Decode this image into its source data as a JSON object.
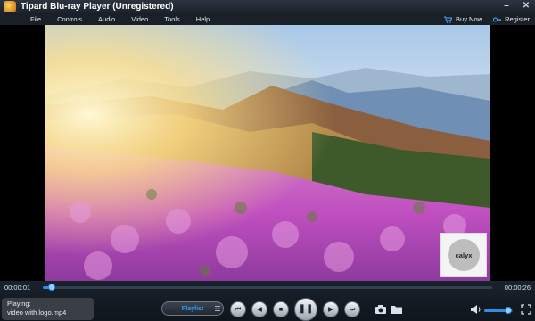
{
  "window": {
    "title": "Tipard Blu-ray Player (Unregistered)",
    "minimize_symbol": "–",
    "close_symbol": "✕"
  },
  "menu": {
    "items": [
      "File",
      "Controls",
      "Audio",
      "Video",
      "Tools",
      "Help"
    ],
    "buy_now": "Buy Now",
    "register": "Register"
  },
  "video": {
    "watermark_text": "calyx"
  },
  "player": {
    "time_current": "00:00:01",
    "time_total": "00:00:26",
    "seek_progress": 0.02,
    "now_playing_label": "Playing:",
    "now_playing_file": "video with logo.mp4",
    "playlist_label": "Playlist",
    "volume_level": 0.85
  },
  "icons": {
    "cart": "cart-icon",
    "key": "key-icon",
    "prev": "skip-back-icon",
    "rewind": "rewind-icon",
    "stop": "stop-icon",
    "pause": "pause-icon",
    "forward": "fast-forward-icon",
    "next": "skip-forward-icon",
    "snapshot": "camera-icon",
    "folder": "folder-icon",
    "volume": "volume-icon",
    "fullscreen": "fullscreen-icon"
  },
  "colors": {
    "accent": "#2f8de8"
  }
}
